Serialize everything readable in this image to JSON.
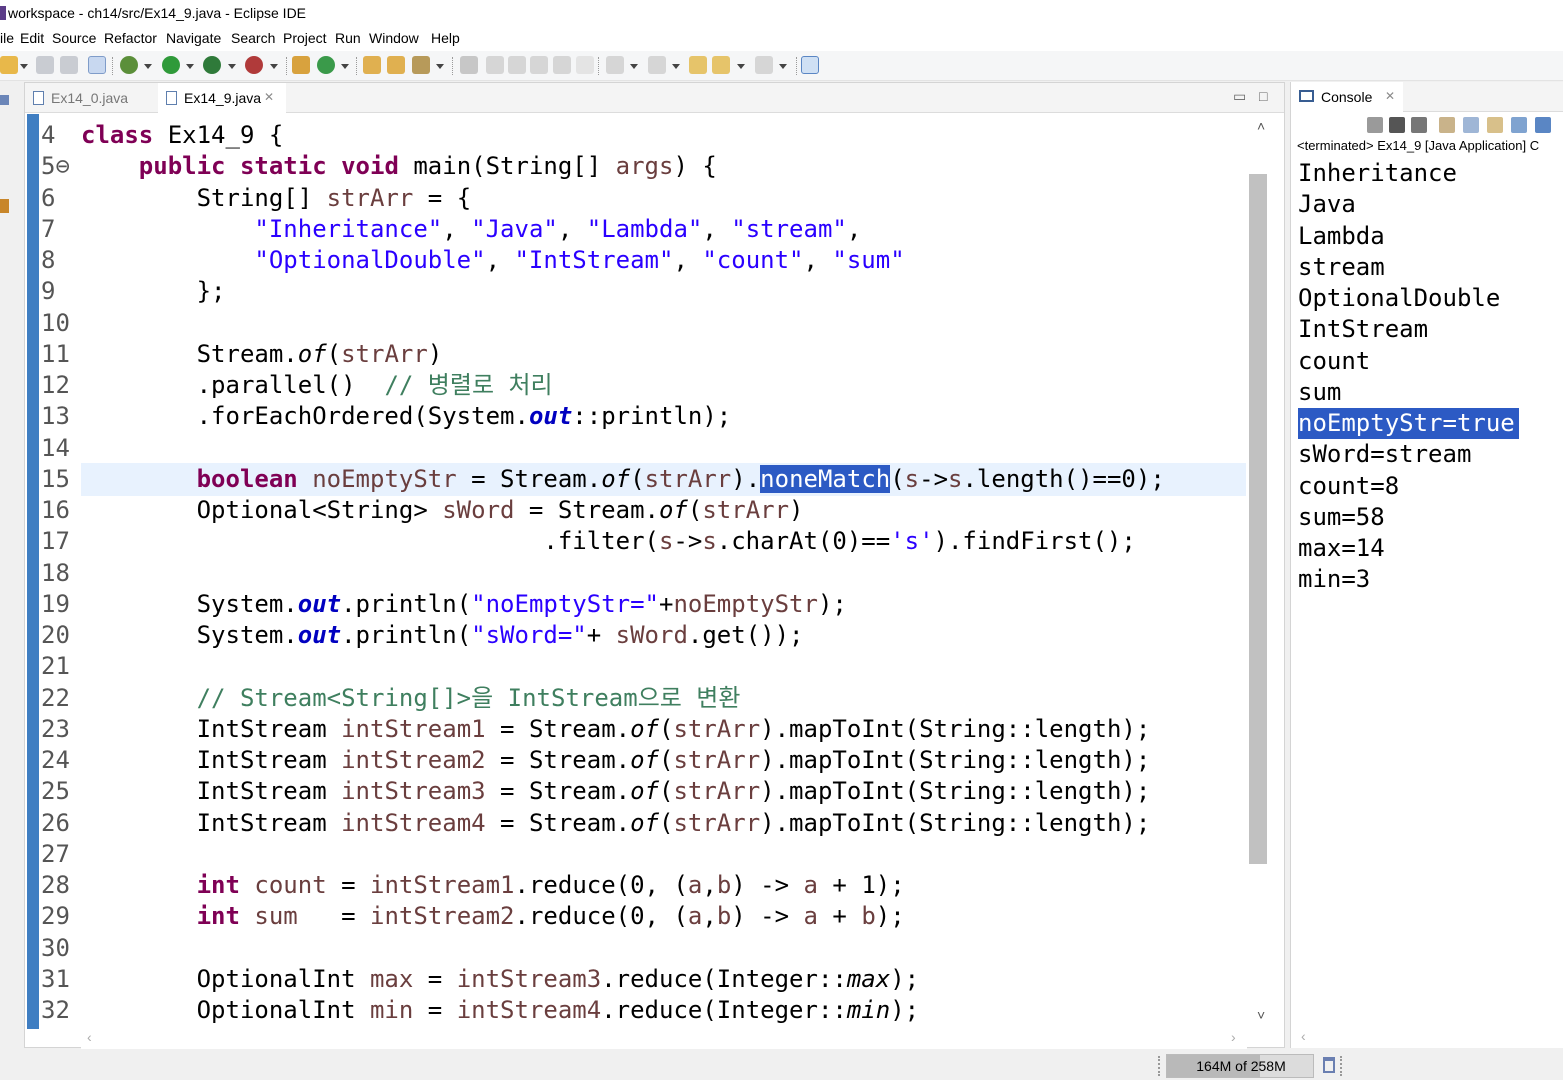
{
  "window": {
    "title": "workspace - ch14/src/Ex14_9.java - Eclipse IDE"
  },
  "menu": [
    "ile",
    "Edit",
    "Source",
    "Refactor",
    "Navigate",
    "Search",
    "Project",
    "Run",
    "Window",
    "Help"
  ],
  "editor": {
    "tabs": [
      {
        "label": "Ex14_0.java",
        "active": false
      },
      {
        "label": "Ex14_9.java",
        "active": true
      }
    ],
    "current_line": 15,
    "selected_word": "noneMatch",
    "lines": [
      {
        "n": "4",
        "code": "class Ex14_9 {"
      },
      {
        "n": "5⊖",
        "code": "    public static void main(String[] args) {"
      },
      {
        "n": "6",
        "code": "        String[] strArr = {"
      },
      {
        "n": "7",
        "code": "            \"Inheritance\", \"Java\", \"Lambda\", \"stream\","
      },
      {
        "n": "8",
        "code": "            \"OptionalDouble\", \"IntStream\", \"count\", \"sum\""
      },
      {
        "n": "9",
        "code": "        };"
      },
      {
        "n": "10",
        "code": ""
      },
      {
        "n": "11",
        "code": "        Stream.of(strArr)"
      },
      {
        "n": "12",
        "code": "        .parallel()  // 병렬로 처리"
      },
      {
        "n": "13",
        "code": "        .forEachOrdered(System.out::println);"
      },
      {
        "n": "14",
        "code": ""
      },
      {
        "n": "15",
        "code": "        boolean noEmptyStr = Stream.of(strArr).noneMatch(s->s.length()==0);"
      },
      {
        "n": "16",
        "code": "        Optional<String> sWord = Stream.of(strArr)"
      },
      {
        "n": "17",
        "code": "                                .filter(s->s.charAt(0)=='s').findFirst();"
      },
      {
        "n": "18",
        "code": ""
      },
      {
        "n": "19",
        "code": "        System.out.println(\"noEmptyStr=\"+noEmptyStr);"
      },
      {
        "n": "20",
        "code": "        System.out.println(\"sWord=\"+ sWord.get());"
      },
      {
        "n": "21",
        "code": ""
      },
      {
        "n": "22",
        "code": "        // Stream<String[]>을 IntStream으로 변환"
      },
      {
        "n": "23",
        "code": "        IntStream intStream1 = Stream.of(strArr).mapToInt(String::length);"
      },
      {
        "n": "24",
        "code": "        IntStream intStream2 = Stream.of(strArr).mapToInt(String::length);"
      },
      {
        "n": "25",
        "code": "        IntStream intStream3 = Stream.of(strArr).mapToInt(String::length);"
      },
      {
        "n": "26",
        "code": "        IntStream intStream4 = Stream.of(strArr).mapToInt(String::length);"
      },
      {
        "n": "27",
        "code": ""
      },
      {
        "n": "28",
        "code": "        int count = intStream1.reduce(0, (a,b) -> a + 1);"
      },
      {
        "n": "29",
        "code": "        int sum   = intStream2.reduce(0, (a,b) -> a + b);"
      },
      {
        "n": "30",
        "code": ""
      },
      {
        "n": "31",
        "code": "        OptionalInt max = intStream3.reduce(Integer::max);"
      },
      {
        "n": "32",
        "code": "        OptionalInt min = intStream4.reduce(Integer::min);"
      }
    ]
  },
  "console": {
    "tab_label": "Console",
    "status": "<terminated> Ex14_9 [Java Application] C",
    "output": [
      "Inheritance",
      "Java",
      "Lambda",
      "stream",
      "OptionalDouble",
      "IntStream",
      "count",
      "sum",
      "noEmptyStr=true",
      "sWord=stream",
      "count=8",
      "sum=58",
      "max=14",
      "min=3"
    ],
    "selected_output": "noEmptyStr=true"
  },
  "status_bar": {
    "heap": "164M of 258M",
    "heap_used_fraction": 0.64
  },
  "colors": {
    "keyword": "#7f0055",
    "string": "#2a00ff",
    "local_var": "#6a3e3e",
    "comment": "#3f7f5f",
    "field": "#0000c0",
    "selection": "#2c5ac4",
    "current_line": "#e8f2fe"
  }
}
